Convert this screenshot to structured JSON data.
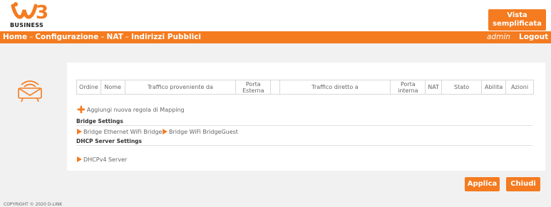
{
  "header": {
    "brand_text": "BUSINESS",
    "vista_button_line1": "Vista",
    "vista_button_line2": "semplificata",
    "accent_color": "#f47b20"
  },
  "nav": {
    "breadcrumb": [
      "Home",
      "Configurazione",
      "NAT",
      "Indirizzi Pubblici"
    ],
    "separator": "–",
    "user": "admin",
    "logout": "Logout"
  },
  "table": {
    "headers": [
      "Ordine",
      "Nome",
      "Traffico proveniente da",
      "Porta Esterna",
      "",
      "Traffico diretto a",
      "Porta interna",
      "NAT",
      "Stato",
      "Abilita",
      "Azioni"
    ]
  },
  "add_rule": "Aggiungi nuova regola di Mapping",
  "bridge": {
    "title": "Bridge Settings",
    "links": [
      "Bridge Ethernet WiFi Bridge",
      "Bridge WiFi BridgeGuest"
    ]
  },
  "dhcp": {
    "title": "DHCP Server Settings",
    "links": [
      "DHCPv4 Server"
    ]
  },
  "buttons": {
    "apply": "Applica",
    "close": "Chiudi"
  },
  "footer": {
    "copyright": "COPYRIGHT © 2020 D-LINK"
  }
}
